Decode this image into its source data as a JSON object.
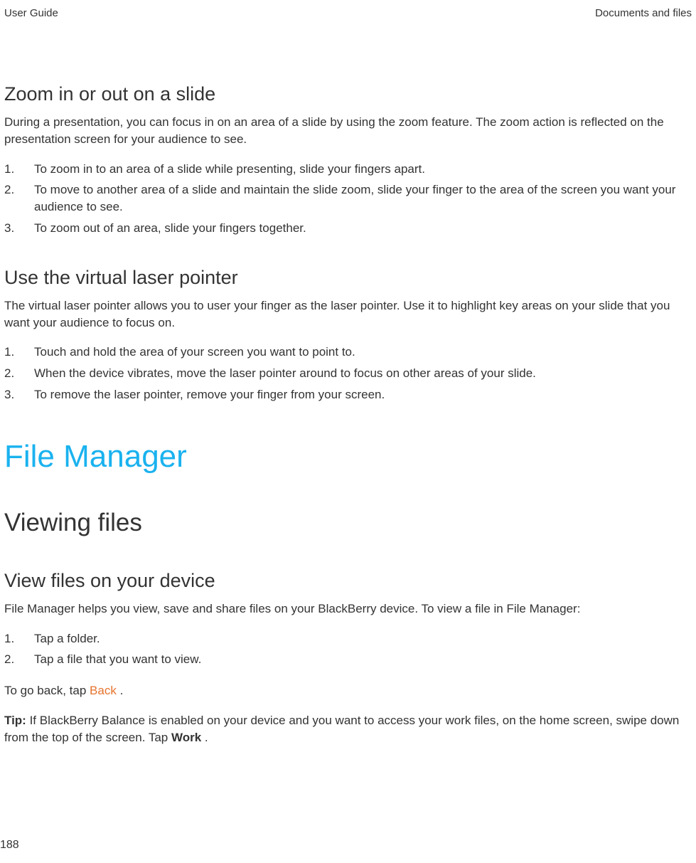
{
  "header": {
    "left": "User Guide",
    "right": "Documents and files"
  },
  "sections": {
    "zoom": {
      "title": "Zoom in or out on a slide",
      "intro": "During a presentation, you can focus in on an area of a slide by using the zoom feature. The zoom action is reflected on the presentation screen for your audience to see.",
      "steps": [
        "To zoom in to an area of a slide while presenting, slide your fingers apart.",
        "To move to another area of a slide and maintain the slide zoom, slide your finger to the area of the screen you want your audience to see.",
        "To zoom out of an area, slide your fingers together."
      ]
    },
    "laser": {
      "title": "Use the virtual laser pointer",
      "intro": "The virtual laser pointer allows you to user your finger as the laser pointer. Use it to highlight key areas on your slide that you want your audience to focus on.",
      "steps": [
        "Touch and hold the area of your screen you want to point to.",
        "When the device vibrates, move the laser pointer around to focus on other areas of your slide.",
        "To remove the laser pointer, remove your finger from your screen."
      ]
    },
    "filemanager": {
      "title": "File Manager"
    },
    "viewing": {
      "title": "Viewing files"
    },
    "viewdevice": {
      "title": "View files on your device",
      "intro": "File Manager helps you view, save and share files on your BlackBerry device. To view a file in File Manager:",
      "steps": [
        "Tap a folder.",
        "Tap a file that you want to view."
      ],
      "goback_pre": "To go back, tap  ",
      "goback_accent": "Back ",
      "goback_post": ".",
      "tip_label": "Tip: ",
      "tip_body_pre": "If BlackBerry Balance is enabled on your device and you want to access your work files, on the home screen, swipe down from the top of the screen. Tap ",
      "tip_bold_word": "Work ",
      "tip_body_post": "."
    }
  },
  "page_number": "188"
}
